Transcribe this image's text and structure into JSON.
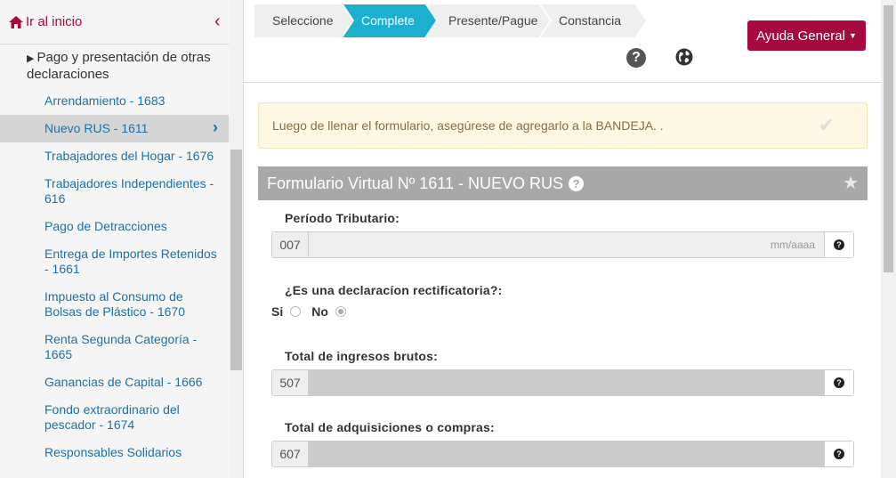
{
  "sidebar": {
    "home_label": "Ir al inicio",
    "section_title": "Pago y presentación de otras declaraciones",
    "items": [
      {
        "label": "Arrendamiento - 1683"
      },
      {
        "label": "Nuevo RUS - 1611",
        "active": true
      },
      {
        "label": "Trabajadores del Hogar - 1676"
      },
      {
        "label": "Trabajadores Independientes - 616"
      },
      {
        "label": "Pago de Detracciones"
      },
      {
        "label": "Entrega de Importes Retenidos - 1661"
      },
      {
        "label": "Impuesto al Consumo de Bolsas de Plástico - 1670"
      },
      {
        "label": "Renta Segunda Categoría - 1665"
      },
      {
        "label": "Ganancias de Capital - 1666"
      },
      {
        "label": "Fondo extraordinario del pescador - 1674"
      },
      {
        "label": "Responsables Solidarios"
      }
    ]
  },
  "wizard": {
    "steps": [
      "Seleccione",
      "Complete",
      "Presente/Pague",
      "Constancia"
    ],
    "active_step": "Complete"
  },
  "header": {
    "help_button_label": "Ayuda General",
    "help_icon_glyph": "?"
  },
  "alert": {
    "message": "Luego de llenar el formulario, asegúrese de agregarlo a la BANDEJA. ."
  },
  "form": {
    "title": "Formulario Virtual Nº 1611 - NUEVO RUS",
    "periodo": {
      "label": "Período Tributario:",
      "code": "007",
      "placeholder": "mm/aaaa"
    },
    "rectificatoria": {
      "label": "¿Es una declaracíon rectificatoria?:",
      "option_si": "Si",
      "option_no": "No",
      "selected": "No"
    },
    "ingresos": {
      "label": "Total de ingresos brutos:",
      "code": "507"
    },
    "adquisiciones": {
      "label": "Total de adquisiciones o compras:",
      "code": "607"
    }
  },
  "colors": {
    "brand": "#a6093d",
    "active_step": "#1cafd0",
    "link": "#1f6fa6",
    "alert_bg": "#fcf8e3",
    "title_bar": "#a8a8a8"
  },
  "icons": [
    "home-icon",
    "chevron-left-icon",
    "chevron-right-icon",
    "question-circle-icon",
    "globe-icon",
    "check-icon",
    "star-icon"
  ]
}
